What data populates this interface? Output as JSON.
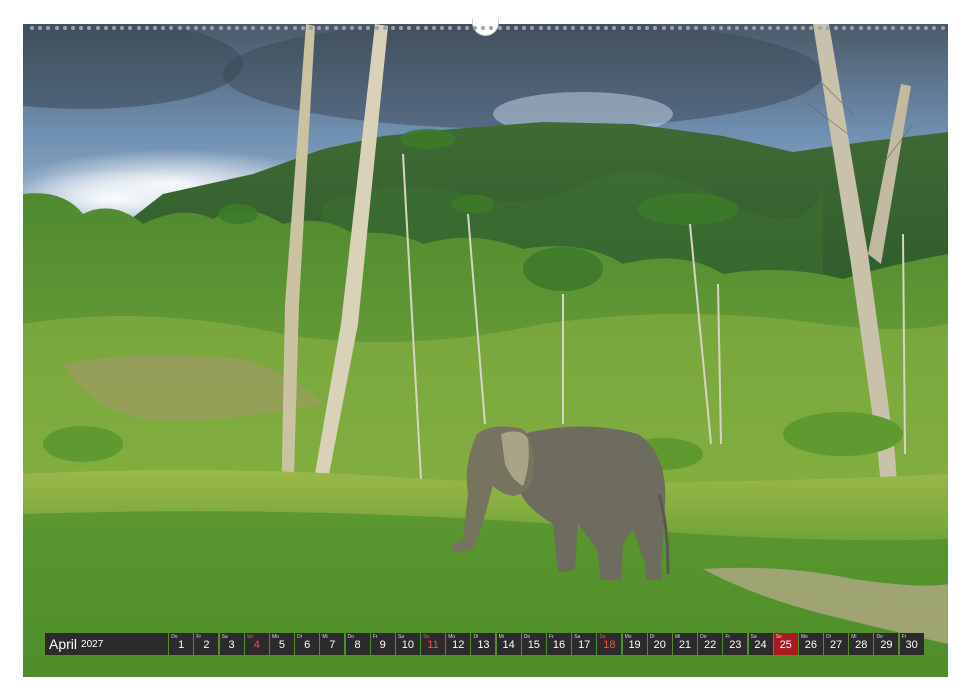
{
  "calendar": {
    "month": "April",
    "year": "2027",
    "days": [
      {
        "wd": "Do",
        "n": "1",
        "kind": "normal"
      },
      {
        "wd": "Fr",
        "n": "2",
        "kind": "normal"
      },
      {
        "wd": "Sa",
        "n": "3",
        "kind": "normal"
      },
      {
        "wd": "So",
        "n": "4",
        "kind": "sun"
      },
      {
        "wd": "Mo",
        "n": "5",
        "kind": "normal"
      },
      {
        "wd": "Di",
        "n": "6",
        "kind": "normal"
      },
      {
        "wd": "Mi",
        "n": "7",
        "kind": "normal"
      },
      {
        "wd": "Do",
        "n": "8",
        "kind": "normal"
      },
      {
        "wd": "Fr",
        "n": "9",
        "kind": "normal"
      },
      {
        "wd": "Sa",
        "n": "10",
        "kind": "normal"
      },
      {
        "wd": "So",
        "n": "11",
        "kind": "sun"
      },
      {
        "wd": "Mo",
        "n": "12",
        "kind": "normal"
      },
      {
        "wd": "Di",
        "n": "13",
        "kind": "normal"
      },
      {
        "wd": "Mi",
        "n": "14",
        "kind": "normal"
      },
      {
        "wd": "Do",
        "n": "15",
        "kind": "normal"
      },
      {
        "wd": "Fr",
        "n": "16",
        "kind": "normal"
      },
      {
        "wd": "Sa",
        "n": "17",
        "kind": "normal"
      },
      {
        "wd": "So",
        "n": "18",
        "kind": "sun"
      },
      {
        "wd": "Mo",
        "n": "19",
        "kind": "normal"
      },
      {
        "wd": "Di",
        "n": "20",
        "kind": "normal"
      },
      {
        "wd": "Mi",
        "n": "21",
        "kind": "normal"
      },
      {
        "wd": "Do",
        "n": "22",
        "kind": "normal"
      },
      {
        "wd": "Fr",
        "n": "23",
        "kind": "normal"
      },
      {
        "wd": "Sa",
        "n": "24",
        "kind": "normal"
      },
      {
        "wd": "So",
        "n": "25",
        "kind": "holiday"
      },
      {
        "wd": "Mo",
        "n": "26",
        "kind": "normal"
      },
      {
        "wd": "Di",
        "n": "27",
        "kind": "normal"
      },
      {
        "wd": "Mi",
        "n": "28",
        "kind": "normal"
      },
      {
        "wd": "Do",
        "n": "29",
        "kind": "normal"
      },
      {
        "wd": "Fr",
        "n": "30",
        "kind": "normal"
      }
    ]
  },
  "colors": {
    "strip": "#2b2b2b",
    "sunday_text": "#ff4a4a",
    "holiday_bg": "#a61c1c"
  },
  "photo": {
    "subject": "elephant-in-jungle-clearing"
  }
}
